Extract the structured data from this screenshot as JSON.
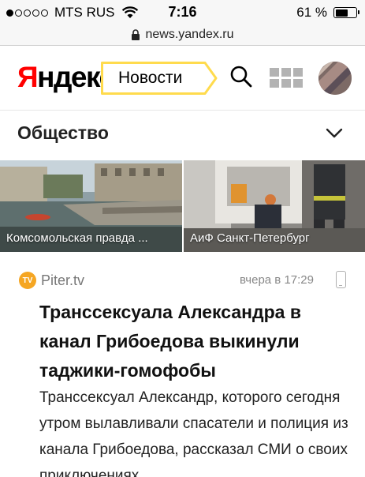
{
  "status_bar": {
    "carrier": "MTS RUS",
    "time": "7:16",
    "battery": "61 %",
    "battery_level": 0.61,
    "signal_bars": 1
  },
  "browser": {
    "url": "news.yandex.ru"
  },
  "header": {
    "logo_first": "Я",
    "logo_rest": "ндекс",
    "service_label": "Новости",
    "accent_color": "#ffdb4d",
    "brand_red": "#ff0000"
  },
  "section": {
    "title": "Общество"
  },
  "photos": [
    {
      "caption": "Комсомольская правда ..."
    },
    {
      "caption": "АиФ Санкт-Петербург"
    }
  ],
  "article": {
    "source_icon": "TV",
    "source": "Piter.tv",
    "time": "вчера в 17:29",
    "headline": "Транссексуала Александра в канал Грибоедова выкинули таджики-гомофобы",
    "snippet": "Транссексуал Александр, которого се­годня утром вылавливали спасатели и полиция из канала Грибоедова, рас­сказал СМИ о своих приключениях."
  }
}
